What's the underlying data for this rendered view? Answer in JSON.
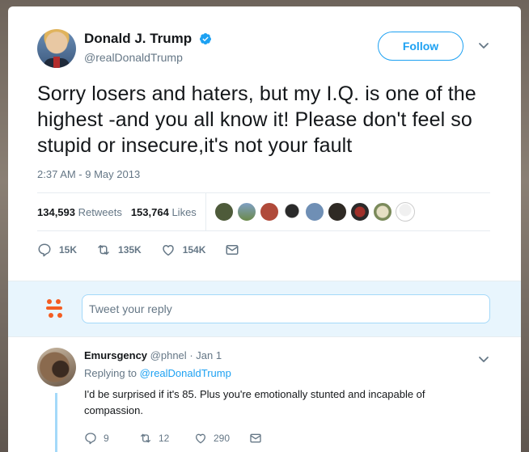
{
  "tweet": {
    "display_name": "Donald J. Trump",
    "handle": "@realDonaldTrump",
    "follow_label": "Follow",
    "text": "Sorry losers and haters, but my I.Q. is one of the highest -and you all know it! Please don't feel so stupid or insecure,it's not your fault",
    "timestamp": "2:37 AM - 9 May 2013",
    "retweets_count": "134,593",
    "retweets_label": "Retweets",
    "likes_count": "153,764",
    "likes_label": "Likes",
    "actions": {
      "reply_count": "15K",
      "retweet_count": "135K",
      "like_count": "154K"
    }
  },
  "reply_box": {
    "placeholder": "Tweet your reply"
  },
  "reply": {
    "display_name": "Emursgency",
    "handle": "@phnel",
    "date": "· Jan 1",
    "replying_prefix": "Replying to",
    "replying_to": "@realDonaldTrump",
    "text": "I'd be surprised if it's 85. Plus you're emotionally stunted and incapable of compassion.",
    "actions": {
      "reply_count": "9",
      "retweet_count": "12",
      "like_count": "290"
    }
  },
  "colors": {
    "accent": "#1da1f2",
    "muted": "#657786",
    "reply_bg": "#e8f5fd"
  }
}
